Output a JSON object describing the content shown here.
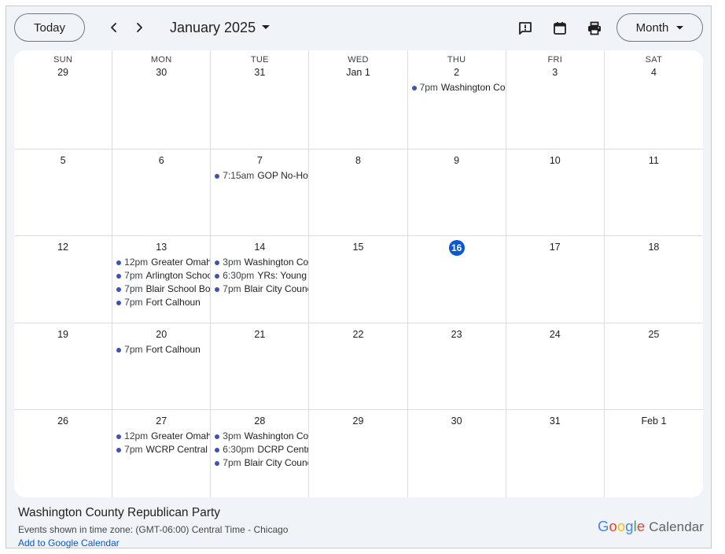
{
  "toolbar": {
    "today_label": "Today",
    "month_title": "January 2025",
    "view_label": "Month",
    "icons": [
      "chevron-left-icon",
      "chevron-right-icon",
      "feedback-icon",
      "calendar-icon",
      "print-icon"
    ]
  },
  "colors": {
    "accent": "#0b57d0",
    "event_dot": "#3f51b5",
    "background": "#f0f4f9",
    "grid_line": "#dadce0"
  },
  "weekdays": [
    "SUN",
    "MON",
    "TUE",
    "WED",
    "THU",
    "FRI",
    "SAT"
  ],
  "weeks": [
    [
      {
        "day": "29",
        "events": []
      },
      {
        "day": "30",
        "events": []
      },
      {
        "day": "31",
        "events": []
      },
      {
        "day": "Jan 1",
        "events": []
      },
      {
        "day": "2",
        "events": [
          {
            "time": "7pm",
            "title": "Washington County Republican Party"
          }
        ]
      },
      {
        "day": "3",
        "events": []
      },
      {
        "day": "4",
        "events": []
      }
    ],
    [
      {
        "day": "5",
        "events": []
      },
      {
        "day": "6",
        "events": []
      },
      {
        "day": "7",
        "events": [
          {
            "time": "7:15am",
            "title": "GOP No-Host Breakfast"
          }
        ]
      },
      {
        "day": "8",
        "events": []
      },
      {
        "day": "9",
        "events": []
      },
      {
        "day": "10",
        "events": []
      },
      {
        "day": "11",
        "events": []
      }
    ],
    [
      {
        "day": "12",
        "events": []
      },
      {
        "day": "13",
        "events": [
          {
            "time": "12pm",
            "title": "Greater Omaha"
          },
          {
            "time": "7pm",
            "title": "Arlington School Board"
          },
          {
            "time": "7pm",
            "title": "Blair School Board"
          },
          {
            "time": "7pm",
            "title": "Fort Calhoun"
          }
        ]
      },
      {
        "day": "14",
        "events": [
          {
            "time": "3pm",
            "title": "Washington County"
          },
          {
            "time": "6:30pm",
            "title": "YRs: Young Republicans"
          },
          {
            "time": "7pm",
            "title": "Blair City Council"
          }
        ]
      },
      {
        "day": "15",
        "events": []
      },
      {
        "day": "16",
        "today": true,
        "events": []
      },
      {
        "day": "17",
        "events": []
      },
      {
        "day": "18",
        "events": []
      }
    ],
    [
      {
        "day": "19",
        "events": []
      },
      {
        "day": "20",
        "events": [
          {
            "time": "7pm",
            "title": "Fort Calhoun"
          }
        ]
      },
      {
        "day": "21",
        "events": []
      },
      {
        "day": "22",
        "events": []
      },
      {
        "day": "23",
        "events": []
      },
      {
        "day": "24",
        "events": []
      },
      {
        "day": "25",
        "events": []
      }
    ],
    [
      {
        "day": "26",
        "events": []
      },
      {
        "day": "27",
        "events": [
          {
            "time": "12pm",
            "title": "Greater Omaha"
          },
          {
            "time": "7pm",
            "title": "WCRP Central Committee"
          }
        ]
      },
      {
        "day": "28",
        "events": [
          {
            "time": "3pm",
            "title": "Washington County"
          },
          {
            "time": "6:30pm",
            "title": "DCRP Central"
          },
          {
            "time": "7pm",
            "title": "Blair City Council"
          }
        ]
      },
      {
        "day": "29",
        "events": []
      },
      {
        "day": "30",
        "events": []
      },
      {
        "day": "31",
        "events": []
      },
      {
        "day": "Feb 1",
        "events": []
      }
    ]
  ],
  "footer": {
    "calendar_name": "Washington County Republican Party",
    "timezone": "Events shown in time zone: (GMT-06:00) Central Time - Chicago",
    "add_link": "Add to Google Calendar",
    "logo_word": "Google",
    "logo_suffix": "Calendar"
  }
}
